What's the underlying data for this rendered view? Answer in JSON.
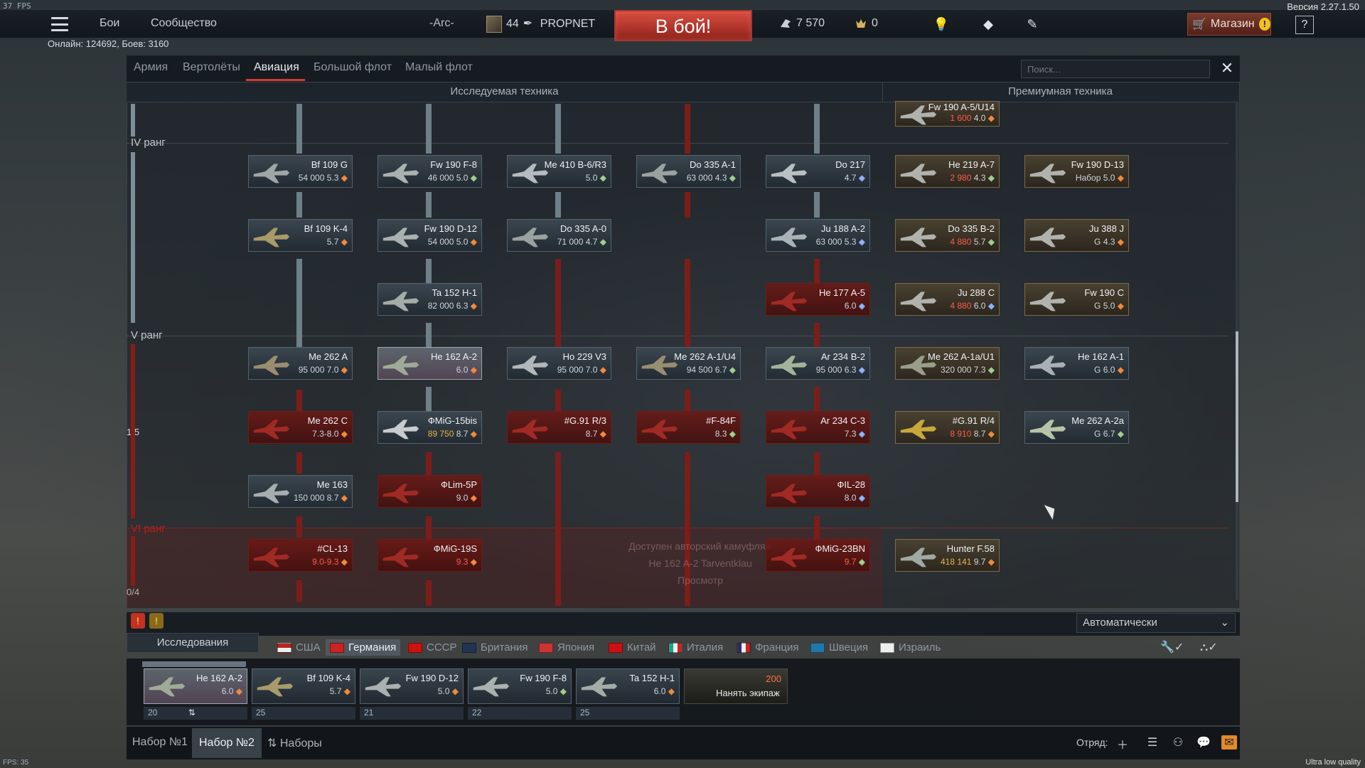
{
  "overlay": {
    "fps_top": "37 FPS",
    "fps_bottom": "FPS: 35",
    "version": "Версия 2.27.1.50",
    "quality": "Ultra low quality"
  },
  "topbar": {
    "menu_icon": "hamburger-menu-icon",
    "battles": "Бои",
    "community": "Сообщество",
    "squad_tag": "-Arc-",
    "player_level": "44",
    "player_name": "PROPNET",
    "battle_button": "В бой!",
    "silver_lions": "7 570",
    "golden_eagles": "0",
    "shop": "Магазин",
    "help": "?",
    "online": "Онлайн: 124692, Боев: 3160"
  },
  "tabs": [
    "Армия",
    "Вертолёты",
    "Авиация",
    "Большой флот",
    "Малый флот"
  ],
  "active_tab": "Авиация",
  "search": {
    "placeholder": "Поиск..."
  },
  "sections": {
    "researched": "Исследуемая техника",
    "premium": "Премиумная техника"
  },
  "ranks": {
    "r4": "IV ранг",
    "r5": "V ранг",
    "r6": "VI ранг",
    "count_5": "1/5",
    "count_6": "0/4"
  },
  "locked_overlay": {
    "line1": "Доступен авторский камуфляж",
    "line2": "He 162 A-2 Tarventklau",
    "line3": "Просмотр"
  },
  "cards": {
    "bf109g": {
      "name": "Bf 109 G",
      "rp": "54 000",
      "br": "5.3"
    },
    "fw190f8": {
      "name": "Fw 190 F-8",
      "rp": "46 000",
      "br": "5.0"
    },
    "me410": {
      "name": "Me 410 B-6/R3",
      "br": "5.0"
    },
    "do335a1": {
      "name": "Do 335 A-1",
      "rp": "63 000",
      "br": "4.3"
    },
    "do217": {
      "name": "Do 217",
      "br": "4.7"
    },
    "bf109k4": {
      "name": "Bf 109 K-4",
      "br": "5.7"
    },
    "fw190d12": {
      "name": "Fw 190 D-12",
      "rp": "54 000",
      "br": "5.0"
    },
    "do335a0": {
      "name": "Do 335 A-0",
      "rp": "71 000",
      "br": "4.7"
    },
    "ju188": {
      "name": "Ju 188 A-2",
      "rp": "63 000",
      "br": "5.3"
    },
    "ta152": {
      "name": "Ta 152 H-1",
      "rp": "82 000",
      "br": "6.3"
    },
    "he177": {
      "name": "He 177 A-5",
      "br": "6.0"
    },
    "me262a": {
      "name": "Me 262 A",
      "rp": "95 000",
      "br": "7.0"
    },
    "he162a2": {
      "name": "He 162 A-2",
      "br": "6.0"
    },
    "ho229": {
      "name": "Ho 229 V3",
      "rp": "95 000",
      "br": "7.0"
    },
    "me262u4": {
      "name": "Me 262 A-1/U4",
      "rp": "94 500",
      "br": "6.7"
    },
    "ar234b2": {
      "name": "Ar 234 B-2",
      "rp": "95 000",
      "br": "6.3"
    },
    "me262c": {
      "name": "Me 262 C",
      "br": "7.3-8.0"
    },
    "mig15": {
      "name": "ФMiG-15bis",
      "rp": "89 750",
      "br": "8.7"
    },
    "g91r3": {
      "name": "#G.91 R/3",
      "br": "8.7"
    },
    "f84f": {
      "name": "#F-84F",
      "br": "8.3"
    },
    "ar234c3": {
      "name": "Ar 234 C-3",
      "br": "7.3"
    },
    "me163": {
      "name": "Me 163",
      "rp": "150 000",
      "br": "8.7"
    },
    "lim5p": {
      "name": "ФLim-5P",
      "br": "9.0"
    },
    "il28": {
      "name": "ФIL-28",
      "br": "8.0"
    },
    "cl13": {
      "name": "#CL-13",
      "br": "9.0-9.3"
    },
    "mig19": {
      "name": "ФMiG-19S",
      "br": "9.3"
    },
    "mig23bn": {
      "name": "ФMiG-23BN",
      "br": "9.7"
    }
  },
  "premium_cards": {
    "fw190a5u14": {
      "name": "Fw 190 A-5/U14",
      "price": "1 600",
      "br": "4.0"
    },
    "he219": {
      "name": "He 219 A-7",
      "price": "2 980",
      "br": "4.3"
    },
    "fw190d13": {
      "name": "Fw 190 D-13",
      "extra": "Набор",
      "br": "5.0"
    },
    "do335b2": {
      "name": "Do 335 B-2",
      "price": "4 880",
      "br": "5.7"
    },
    "ju388": {
      "name": "Ju 388 J",
      "extra": "G",
      "br": "4.3"
    },
    "ju288": {
      "name": "Ju 288 C",
      "price": "4 880",
      "br": "6.0"
    },
    "fw190c": {
      "name": "Fw 190 C",
      "extra": "G",
      "br": "5.0"
    },
    "me262u1": {
      "name": "Me 262 A-1a/U1",
      "price": "320 000",
      "br": "7.3"
    },
    "he162a1": {
      "name": "He 162 A-1",
      "extra": "G",
      "br": "6.0"
    },
    "g91r4": {
      "name": "#G.91 R/4",
      "price": "8 910",
      "br": "8.7"
    },
    "me262a2a": {
      "name": "Me 262 A-2a",
      "extra": "G",
      "br": "6.7"
    },
    "hunter": {
      "name": "Hunter F.58",
      "price": "418 141",
      "br": "9.7"
    }
  },
  "research": {
    "tab": "Исследования",
    "auto": "Автоматически",
    "nations": [
      "США",
      "Германия",
      "СССР",
      "Британия",
      "Япония",
      "Китай",
      "Италия",
      "Франция",
      "Швеция",
      "Израиль"
    ],
    "active_nation": "Германия"
  },
  "crew": [
    {
      "name": "He 162 A-2",
      "br": "6.0",
      "num": "20"
    },
    {
      "name": "Bf 109 K-4",
      "br": "5.7",
      "num": "25"
    },
    {
      "name": "Fw 190 D-12",
      "br": "5.0",
      "num": "21"
    },
    {
      "name": "Fw 190 F-8",
      "br": "5.0",
      "num": "22"
    },
    {
      "name": "Ta 152 H-1",
      "br": "6.0",
      "num": "25"
    }
  ],
  "hire": {
    "price": "200",
    "label": "Нанять экипаж"
  },
  "presets": {
    "p1": "Набор №1",
    "p2": "Набор №2",
    "all": "Наборы"
  },
  "squad_label": "Отряд:",
  "colors": {
    "accent_red": "#d23b2d",
    "locked_red": "#7c1d1a",
    "premium_gold": "#e8b442"
  }
}
